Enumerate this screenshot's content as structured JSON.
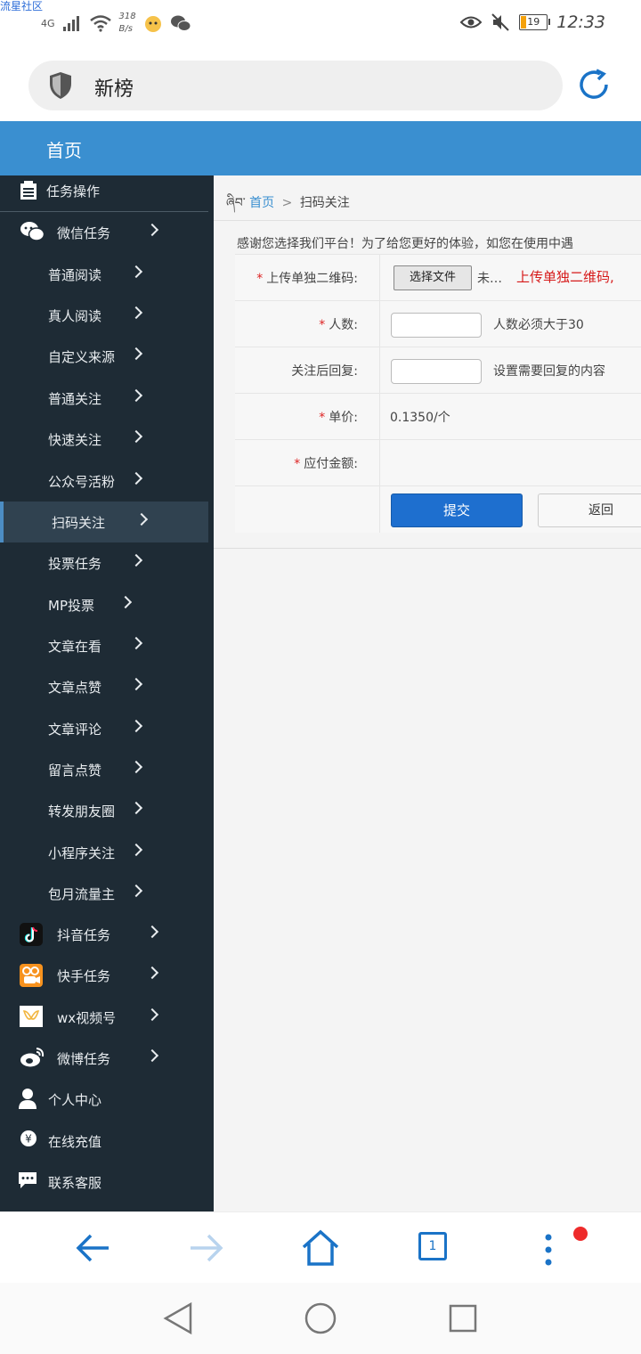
{
  "watermark": "流星社区",
  "status": {
    "network": "4G",
    "speed_value": "318",
    "speed_unit": "B/s",
    "battery": "19",
    "time": "12:33"
  },
  "browser": {
    "url_text": "新榜",
    "tab_count": "1"
  },
  "site": {
    "header_title": "首页"
  },
  "sidebar": {
    "header": "任务操作",
    "items": [
      {
        "label": "微信任务"
      },
      {
        "label": "普通阅读"
      },
      {
        "label": "真人阅读"
      },
      {
        "label": "自定义来源"
      },
      {
        "label": "普通关注"
      },
      {
        "label": "快速关注"
      },
      {
        "label": "公众号活粉"
      },
      {
        "label": "扫码关注"
      },
      {
        "label": "投票任务"
      },
      {
        "label": "MP投票"
      },
      {
        "label": "文章在看"
      },
      {
        "label": "文章点赞"
      },
      {
        "label": "文章评论"
      },
      {
        "label": "留言点赞"
      },
      {
        "label": "转发朋友圈"
      },
      {
        "label": "小程序关注"
      },
      {
        "label": "包月流量主"
      },
      {
        "label": "抖音任务"
      },
      {
        "label": "快手任务"
      },
      {
        "label": "wx视频号"
      },
      {
        "label": "微博任务"
      },
      {
        "label": "个人中心"
      },
      {
        "label": "在线充值"
      },
      {
        "label": "联系客服"
      }
    ]
  },
  "breadcrumb": {
    "prefix": "ཞིབ་",
    "home": "首页",
    "separator": ">",
    "current": "扫码关注"
  },
  "form": {
    "notice": "感谢您选择我们平台！为了给您更好的体验，如您在使用中遇",
    "upload_label": "上传单独二维码:",
    "upload_button": "选择文件",
    "upload_status": "未…",
    "upload_hint": "上传单独二维码,",
    "count_label": "人数:",
    "count_value": "",
    "count_hint": "人数必须大于30",
    "reply_label": "关注后回复:",
    "reply_value": "",
    "reply_hint": "设置需要回复的内容",
    "price_label": "单价:",
    "price_value": "0.1350/个",
    "amount_label": "应付金额:",
    "amount_value": "",
    "submit_label": "提交",
    "back_label": "返回"
  },
  "colors": {
    "header_blue": "#3a8fd0",
    "sidebar_bg": "#1e2b35",
    "submit_blue": "#1e6fcf",
    "warn_red": "#d61a1a"
  }
}
